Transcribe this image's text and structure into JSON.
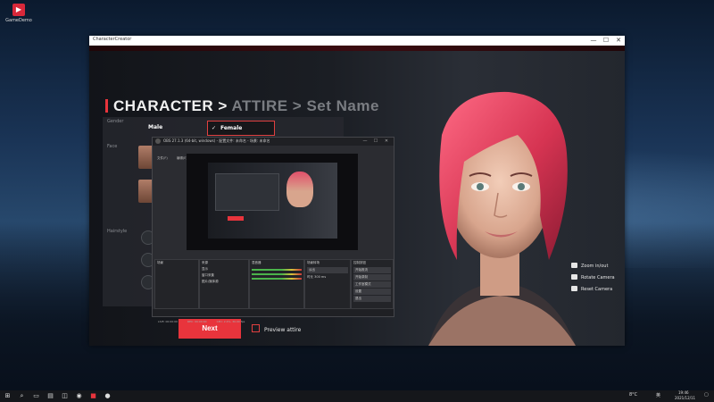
{
  "desktop": {
    "icon_label": "GameDemo"
  },
  "window": {
    "title": "CharacterCreator",
    "controls": [
      "—",
      "☐",
      "✕"
    ]
  },
  "game": {
    "breadcrumb": {
      "current": "CHARACTER",
      "sep1": ">",
      "next": "ATTIRE",
      "sep2": ">",
      "last": "Set Name"
    },
    "sections": {
      "gender": "Gender",
      "face": "Face",
      "hairstyle": "Hairstyle"
    },
    "gender_options": {
      "male": "Male",
      "female": "Female",
      "selected_mark": "✓"
    },
    "next_label": "Next",
    "preview_label": "Preview attire",
    "camera": {
      "zoom": "Zoom in/out",
      "rotate": "Rotate Camera",
      "reset": "Reset Camera"
    },
    "accent_color": "#e8343c"
  },
  "obs": {
    "title": "OBS 27.1.3 (64-bit, windows) - 配置文件: 未命名 - 场景: 未命名",
    "menu": [
      "文件(F)",
      "编辑(E)",
      "视图(V)",
      "停靠部件(D)",
      "配置文件(P)",
      "场景集合(S)",
      "工具(T)",
      "帮助(H)"
    ],
    "scene_label": "场景",
    "sources_label": "来源",
    "sources": [
      "显示",
      "窗口采集",
      "图片/媒体源"
    ],
    "mixer_label": "混音器",
    "transitions_label": "场景转场",
    "controls_label": "控制按钮",
    "controls": [
      "开始推流",
      "开始录制",
      "工作室模式",
      "设置",
      "退出"
    ],
    "transition_value": "淡出",
    "duration_label": "时长",
    "duration_value": "300 ms",
    "status": [
      "LIVE: 00:00:00",
      "REC: 00:00:00",
      "CPU: 2.4%, 30.00 fps"
    ]
  },
  "taskbar": {
    "icons": [
      "windows-icon",
      "search-icon",
      "task-view-icon",
      "explorer-icon",
      "store-icon",
      "steam-icon",
      "game-icon",
      "obs-icon"
    ],
    "weather": "8°C",
    "lang": "英",
    "time": "19:46",
    "date": "2021/12/11"
  }
}
